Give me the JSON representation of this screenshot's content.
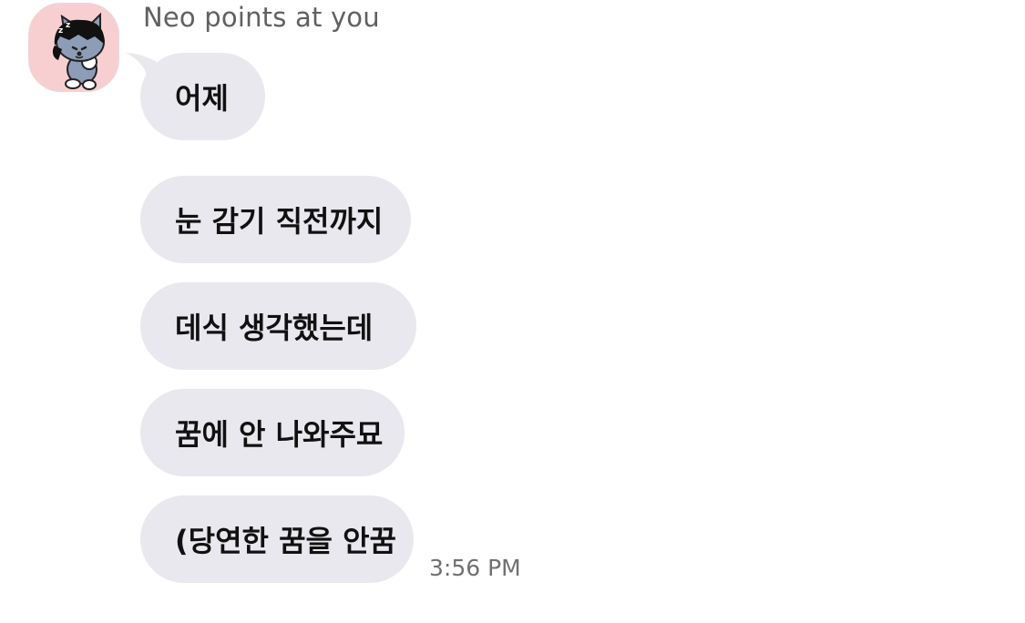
{
  "chat": {
    "sender": "Neo points at you",
    "avatar_icon": "neo-cat-avatar-icon",
    "messages": [
      "어제",
      "눈 감기 직전까지",
      "데식 생각했는데",
      "꿈에 안 나와주묘",
      "(당연한 꿈을 안꿈"
    ],
    "timestamp": "3:56 PM"
  },
  "colors": {
    "bubble": "#e8e8ee",
    "avatar_bg": "#f8cfd0",
    "sender_text": "#606060",
    "timestamp_text": "#707070"
  }
}
